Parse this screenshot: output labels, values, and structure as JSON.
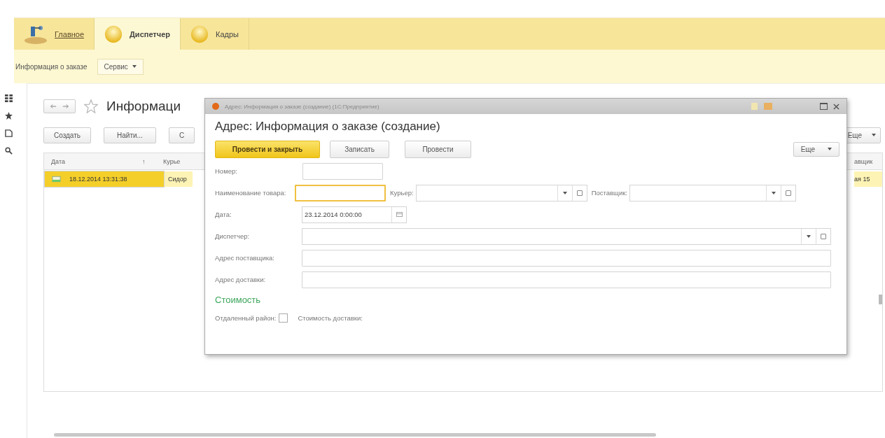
{
  "sections": [
    {
      "label": "Главное",
      "selected": false,
      "kind": "home"
    },
    {
      "label": "Диспетчер",
      "selected": true,
      "kind": "ball"
    },
    {
      "label": "Кадры",
      "selected": false,
      "kind": "ball"
    }
  ],
  "commands": {
    "title": "Информация о заказе",
    "menu": "Сервис"
  },
  "list": {
    "title": "Информаци",
    "buttons": [
      "Создать",
      "Найти...",
      "С"
    ],
    "more": "Еще",
    "columns": [
      {
        "label": "Дата",
        "sort": "↑"
      },
      {
        "label": "Курье"
      },
      {
        "label": "авщик"
      }
    ],
    "rows": [
      {
        "cells": [
          "18.12.2014 13:31:38",
          "Сидор",
          "ая 15"
        ],
        "selected": true
      }
    ]
  },
  "dialog": {
    "window_title": "Адрес: Информация о заказе (создание)  (1С:Предприятие)",
    "heading": "Адрес: Информация о заказе (создание)",
    "buttons": [
      {
        "label": "Провести и закрыть",
        "kind": "default"
      },
      {
        "label": "Записать",
        "kind": "normal"
      },
      {
        "label": "Провести",
        "kind": "normal"
      }
    ],
    "more": "Еще",
    "number_label": "Номер:",
    "product_label": "Наименование товара:",
    "product_focused": true,
    "courier_label": "Курьер:",
    "supplier_label": "Поставщик:",
    "date_label": "Дата:",
    "date_value": "23.12.2014  0:00:00",
    "dispatcher_label": "Диспетчер:",
    "supplier_address_label": "Адрес поставщика:",
    "delivery_address_label": "Адрес доставки:",
    "group_title": "Стоимость",
    "remote_label": "Отдаленный район:",
    "remote_checked": false,
    "cost_label": "Стоимость доставки:"
  }
}
